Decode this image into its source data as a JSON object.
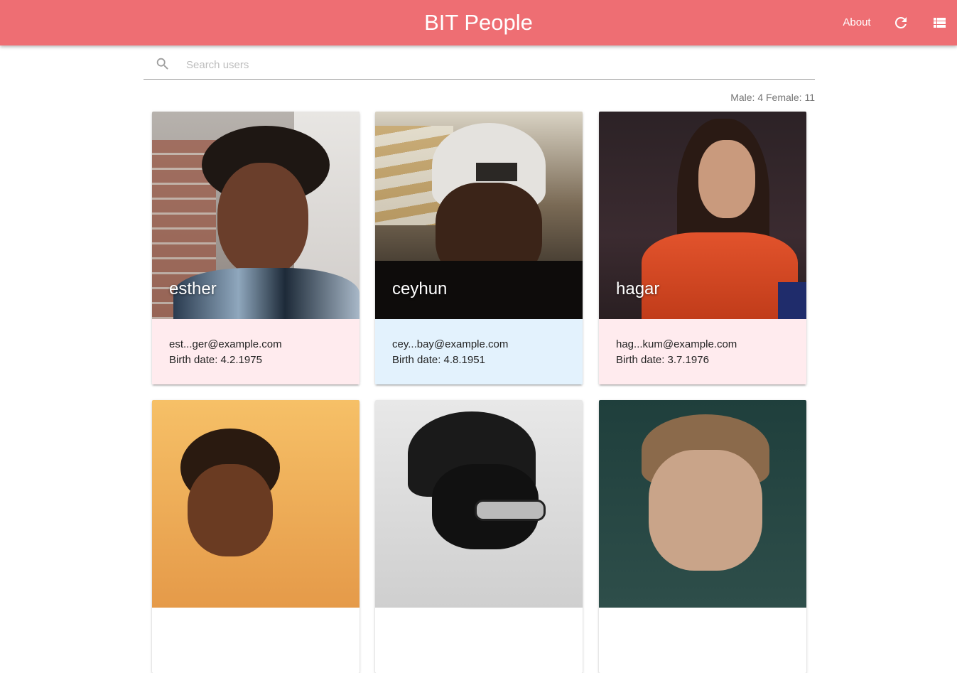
{
  "app": {
    "title": "BIT People",
    "nav": {
      "about_label": "About"
    },
    "icons": {
      "refresh": "refresh-icon",
      "view_toggle": "list-view-icon",
      "search": "search-icon"
    },
    "colors": {
      "navbar": "#ee6e73",
      "female_card": "#ffebee",
      "male_card": "#e3f2fd"
    }
  },
  "search": {
    "placeholder": "Search users",
    "value": ""
  },
  "stats": {
    "text": "Male: 4 Female: 11",
    "male": 4,
    "female": 11
  },
  "users": [
    {
      "name": "esther",
      "email": "est...ger@example.com",
      "birth": "Birth date: 4.2.1975",
      "gender": "female"
    },
    {
      "name": "ceyhun",
      "email": "cey...bay@example.com",
      "birth": "Birth date: 4.8.1951",
      "gender": "male"
    },
    {
      "name": "hagar",
      "email": "hag...kum@example.com",
      "birth": "Birth date: 3.7.1976",
      "gender": "female"
    },
    {
      "name": "",
      "email": "",
      "birth": "",
      "gender": ""
    },
    {
      "name": "",
      "email": "",
      "birth": "",
      "gender": ""
    },
    {
      "name": "",
      "email": "",
      "birth": "",
      "gender": ""
    }
  ]
}
